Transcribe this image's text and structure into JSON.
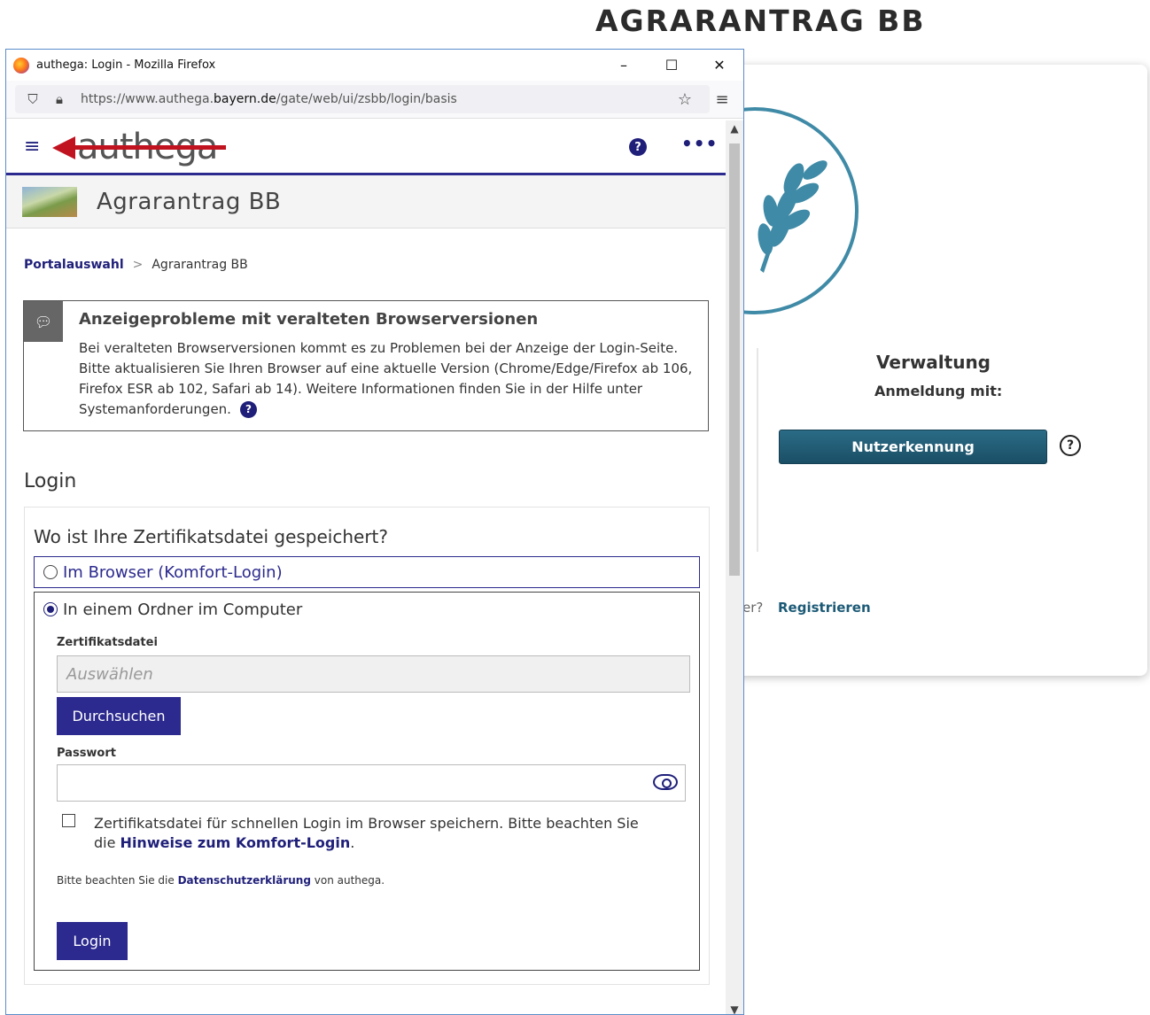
{
  "background": {
    "title": "AGRARANTRAG BB",
    "admin_title": "Verwaltung",
    "admin_sub": "Anmeldung mit:",
    "admin_button": "Nutzerkennung",
    "help_glyph": "?",
    "register_question_fragment": "er?",
    "register_link": "Registrieren"
  },
  "window": {
    "title": "authega: Login - Mozilla Firefox",
    "controls": {
      "minimize": "–",
      "maximize": "☐",
      "close": "✕"
    },
    "url_prefix": "https://www.authega.",
    "url_domain": "bayern.de",
    "url_suffix": "/gate/web/ui/zsbb/login/basis"
  },
  "header": {
    "brand": "authega",
    "help_glyph": "?",
    "more_glyph": "•••"
  },
  "app": {
    "name": "Agrarantrag  BB"
  },
  "breadcrumb": {
    "root": "Portalauswahl",
    "separator": ">",
    "current": "Agrarantrag BB"
  },
  "notice": {
    "title": "Anzeigeprobleme mit veralteten Browserversionen",
    "text": "Bei veralteten Browserversionen kommt es zu Problemen bei der Anzeige der Login-Seite. Bitte aktualisieren Sie Ihren Browser auf eine aktuelle Version (Chrome/Edge/Firefox ab 106, Firefox ESR ab 102, Safari ab 14). Weitere Informationen finden Sie in der Hilfe unter Systemanforderungen.",
    "help_glyph": "?"
  },
  "login": {
    "heading": "Login",
    "question": "Wo ist Ihre Zertifikatsdatei gespeichert?",
    "option_browser": "Im Browser (Komfort-Login)",
    "option_folder": "In einem Ordner im Computer",
    "cert_label": "Zertifikatsdatei",
    "cert_placeholder": "Auswählen",
    "browse_button": "Durchsuchen",
    "password_label": "Passwort",
    "save_text": "Zertifikatsdatei für schnellen Login im Browser speichern. Bitte beachten Sie die",
    "save_link": "Hinweise zum Komfort-Login",
    "save_end": ".",
    "privacy_prefix": "Bitte beachten Sie die",
    "privacy_link": "Datenschutzerklärung",
    "privacy_suffix": "von authega.",
    "submit_button": "Login"
  }
}
